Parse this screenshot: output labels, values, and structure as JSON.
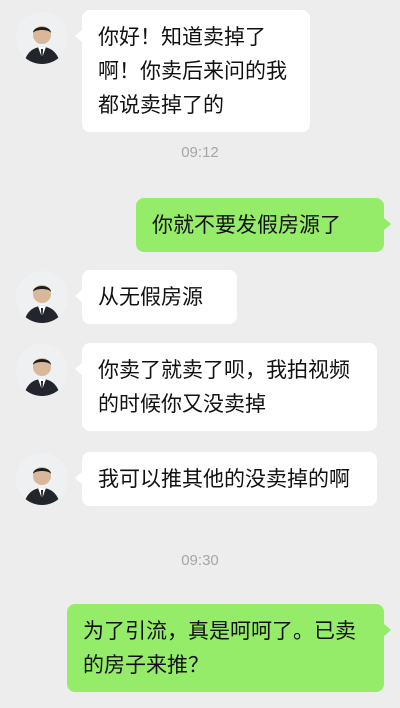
{
  "chat": {
    "messages": [
      {
        "from": "contact",
        "text": "你好！知道卖掉了啊！你卖后来问的我都说卖掉了的"
      },
      {
        "time": "09:12"
      },
      {
        "from": "me",
        "text": "你就不要发假房源了"
      },
      {
        "from": "contact",
        "text": "从无假房源"
      },
      {
        "from": "contact",
        "text": "你卖了就卖了呗，我拍视频的时候你又没卖掉"
      },
      {
        "from": "contact",
        "text": "我可以推其他的没卖掉的啊"
      },
      {
        "time": "09:30"
      },
      {
        "from": "me",
        "text": "为了引流，真是呵呵了。已卖的房子来推？"
      }
    ]
  },
  "colors": {
    "background": "#ededed",
    "incoming_bubble": "#ffffff",
    "outgoing_bubble": "#95ec69",
    "timestamp": "#a6a6a6"
  },
  "icons": {
    "contact_avatar": "person-in-suit-avatar"
  }
}
